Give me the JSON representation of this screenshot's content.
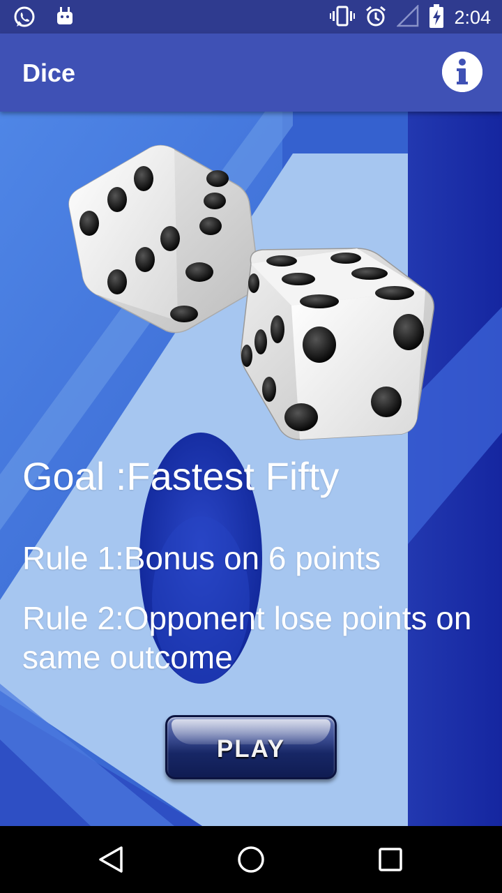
{
  "status_bar": {
    "time": "2:04",
    "left_icons": [
      "whatsapp-icon",
      "android-icon"
    ],
    "right_icons": [
      "vibrate-icon",
      "alarm-icon",
      "signal-icon",
      "battery-icon"
    ]
  },
  "app_bar": {
    "title": "Dice",
    "info_icon": "info-icon"
  },
  "main": {
    "goal": "Goal :Fastest Fifty",
    "rule1": "Rule 1:Bonus on 6 points",
    "rule2": "Rule 2:Opponent lose points on same outcome",
    "play_label": "PLAY"
  },
  "nav_bar": {
    "icons": [
      "back-icon",
      "home-icon",
      "recent-apps-icon"
    ]
  },
  "colors": {
    "status_bar": "#2f3b8f",
    "app_bar": "#3f51b5",
    "background_blue": "#3e6bd6",
    "dark_blue": "#1a2aa8",
    "light_blue": "#9fc2ef"
  }
}
